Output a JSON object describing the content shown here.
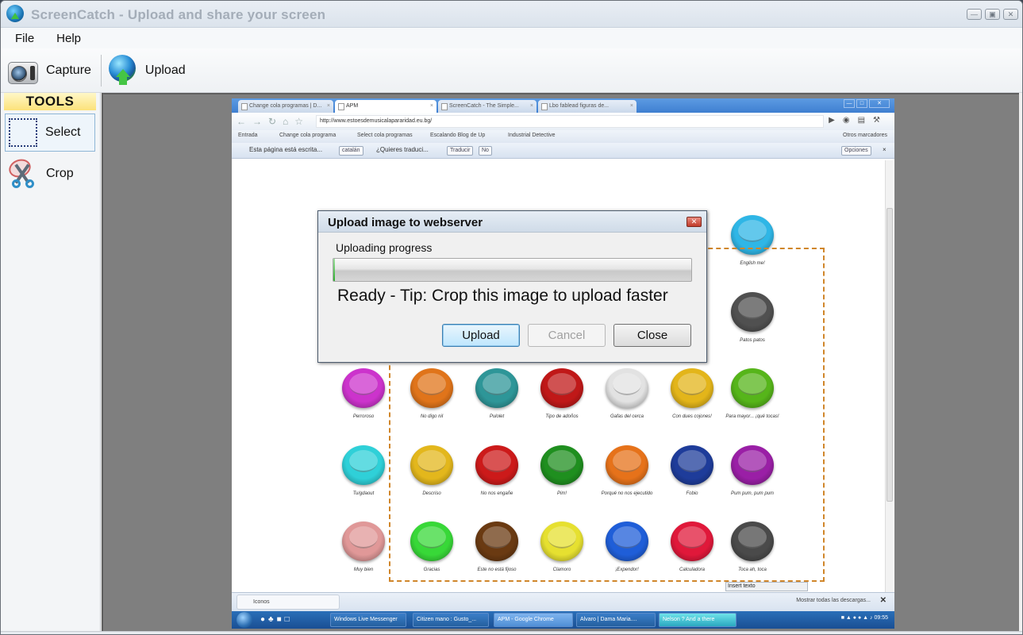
{
  "window": {
    "title": "ScreenCatch - Upload and share your screen",
    "controls": [
      "minimize",
      "maximize",
      "close"
    ]
  },
  "menu": [
    "File",
    "Help"
  ],
  "toolbar": {
    "capture_label": "Capture",
    "upload_label": "Upload"
  },
  "sidebar": {
    "header": "TOOLS",
    "tools": [
      {
        "label": "Select",
        "icon": "select-rectangle-icon",
        "selected": true
      },
      {
        "label": "Crop",
        "icon": "scissors-icon",
        "selected": false
      }
    ]
  },
  "captured_screen": {
    "browser_tabs": [
      {
        "label": "Change cola programas | D...",
        "active": false
      },
      {
        "label": "APM",
        "active": true
      },
      {
        "label": "ScreenCatch - The Simple...",
        "active": false
      },
      {
        "label": "Lbo fablead figuras de...",
        "active": false
      }
    ],
    "url": "http://www.estoesdemusicalapararidad.eu.bg/",
    "bookmarks": [
      "Entrada",
      "Change cola programa",
      "Select cola programas",
      "Escalando Blog de Up",
      "Industrial Detective",
      "Otros marcadores"
    ],
    "translate_bar": {
      "message": "Esta página está escrita...",
      "language": "catalán",
      "question": "¿Quieres traduci...",
      "translate_btn": "Traducir",
      "no_btn": "No",
      "options_btn": "Opciones"
    },
    "sound_buttons": [
      {
        "caption": "English me!",
        "color": "#2fb6e6"
      },
      {
        "caption": "Patos patos",
        "color": "#505050"
      },
      {
        "caption": "Perroroso",
        "color": "#cc33cc"
      },
      {
        "caption": "No digo nil",
        "color": "#e0741a"
      },
      {
        "caption": "Pulolet",
        "color": "#2e9698"
      },
      {
        "caption": "Tipo de adoños",
        "color": "#c01818"
      },
      {
        "caption": "Gafas del cerca",
        "color": "#e2e2e2"
      },
      {
        "caption": "Con dues cojones!",
        "color": "#e3b51a"
      },
      {
        "caption": "Para mayor... ¡qué tocas!",
        "color": "#56b51a"
      },
      {
        "caption": "Tu/gdaout",
        "color": "#2fd0d8"
      },
      {
        "caption": "Descriso",
        "color": "#e3b71c"
      },
      {
        "caption": "No nos engañe",
        "color": "#cc1a1a"
      },
      {
        "caption": "Pim!",
        "color": "#1f8f1f"
      },
      {
        "caption": "Porqué no nos ejecutido",
        "color": "#e6721a"
      },
      {
        "caption": "Fobio",
        "color": "#1e3c9a"
      },
      {
        "caption": "Pum pum, pum pum",
        "color": "#9a1fa6"
      },
      {
        "caption": "Muy bien",
        "color": "#e09898"
      },
      {
        "caption": "Gracias",
        "color": "#38d838"
      },
      {
        "caption": "Este no está fijoso",
        "color": "#6a3a12"
      },
      {
        "caption": "Clamoro",
        "color": "#e6e030"
      },
      {
        "caption": "¡Expendor!",
        "color": "#1f5ed8"
      },
      {
        "caption": "Calculadora",
        "color": "#e0183a"
      },
      {
        "caption": "Toca ah, toca",
        "color": "#4a4a4a"
      }
    ],
    "hover_input": "Insert texto",
    "downloads": {
      "item": "Iconos",
      "show_all": "Mostrar todas las descargas..."
    },
    "taskbar": {
      "tasks": [
        {
          "label": "Windows Live Messenger",
          "state": "normal"
        },
        {
          "label": "Citizen mano : Gusto_...",
          "state": "normal"
        },
        {
          "label": "APM - Google Chrome",
          "state": "active"
        },
        {
          "label": "Alvaro | Dama Maria....",
          "state": "normal"
        },
        {
          "label": "Nelson ? And a there",
          "state": "flash"
        }
      ],
      "clock": "09:55"
    }
  },
  "dialog": {
    "title": "Upload image to webserver",
    "progress_label": "Uploading progress",
    "progress_value": 0.005,
    "status": "Ready - Tip: Crop this image to upload faster",
    "buttons": [
      {
        "label": "Upload",
        "enabled": true,
        "default": true
      },
      {
        "label": "Cancel",
        "enabled": false,
        "default": false
      },
      {
        "label": "Close",
        "enabled": true,
        "default": false
      }
    ]
  }
}
